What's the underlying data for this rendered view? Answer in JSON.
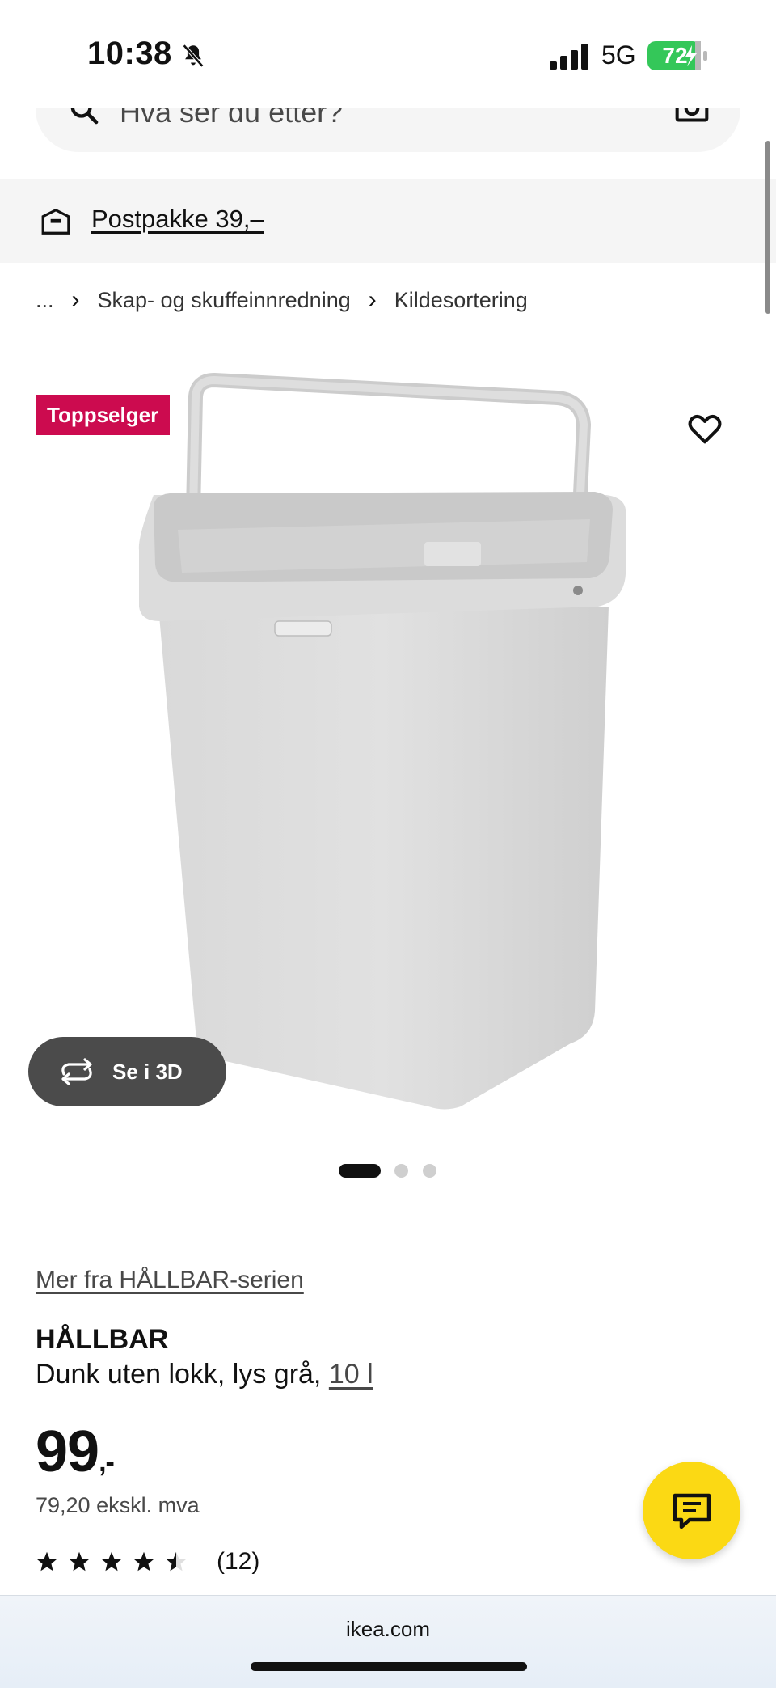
{
  "status_bar": {
    "time": "10:38",
    "network": "5G",
    "battery": "72",
    "icons": [
      "bell-slash-icon",
      "signal-icon",
      "battery-charging-icon"
    ]
  },
  "search": {
    "placeholder": "Hva ser du etter?",
    "icons": [
      "search-icon",
      "camera-icon"
    ]
  },
  "delivery": {
    "text": "Postpakke 39,–",
    "icon": "delivery-box-icon"
  },
  "breadcrumb": {
    "items": [
      "...",
      "Skap- og skuffeinnredning",
      "Kildesortering"
    ]
  },
  "product": {
    "badge": "Toppselger",
    "view_3d_label": "Se i 3D",
    "carousel": {
      "total": 3,
      "active": 1
    },
    "series_link": "Mer fra HÅLLBAR-serien",
    "name": "HÅLLBAR",
    "description": "Dunk uten lokk, lys grå,",
    "size": "10 l",
    "price": "99",
    "price_suffix": ",-",
    "price_excl_vat": "79,20 ekskl. mva",
    "rating": 4.5,
    "rating_max": 5,
    "review_count": "(12)"
  },
  "browser": {
    "url": "ikea.com"
  },
  "colors": {
    "badge": "#cc0b4f",
    "chat_button": "#fbd914",
    "battery": "#34c759"
  }
}
